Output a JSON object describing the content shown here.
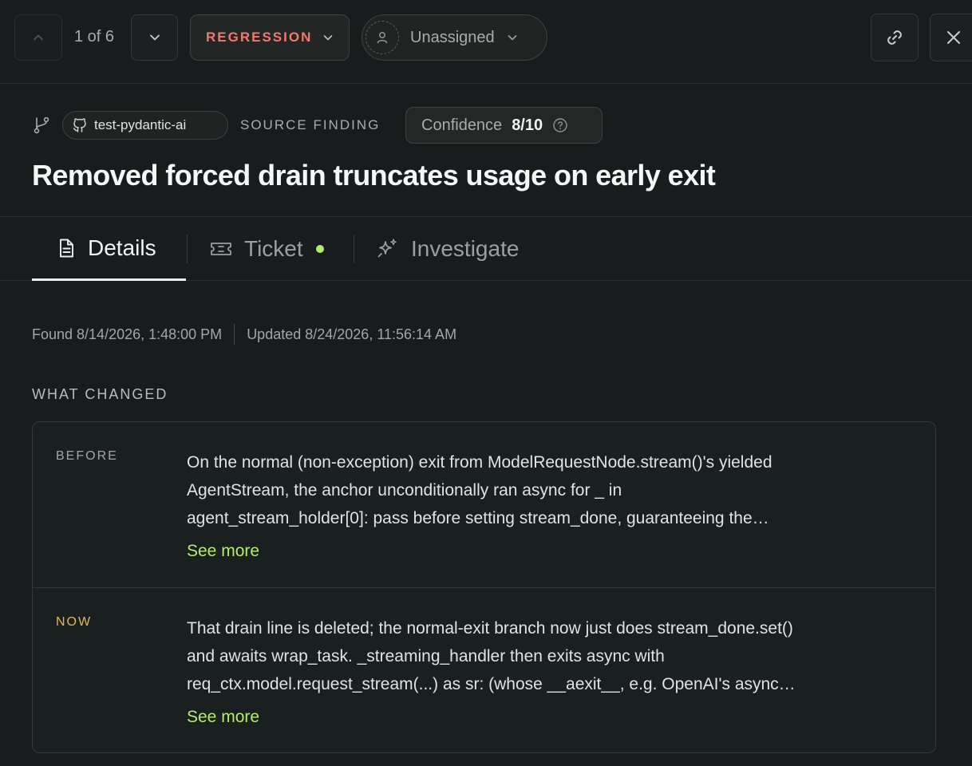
{
  "toolbar": {
    "pager": "1 of 6",
    "status": "REGRESSION",
    "assignee": "Unassigned"
  },
  "header": {
    "repo": "test-pydantic-ai",
    "source": "SOURCE FINDING",
    "confidence_label": "Confidence",
    "confidence_value": "8/10",
    "title": "Removed forced drain truncates usage on early exit"
  },
  "tabs": [
    {
      "label": "Details",
      "active": true,
      "icon": "document-icon"
    },
    {
      "label": "Ticket",
      "active": false,
      "icon": "ticket-icon",
      "indicator": true
    },
    {
      "label": "Investigate",
      "active": false,
      "icon": "sparkles-icon"
    }
  ],
  "timestamps": {
    "found": "Found 8/14/2026, 1:48:00 PM",
    "updated": "Updated 8/24/2026, 11:56:14 AM"
  },
  "what_changed": {
    "heading": "WHAT CHANGED",
    "before": {
      "label": "BEFORE",
      "lines": [
        "On the normal (non-exception) exit from ModelRequestNode.stream()'s yielded",
        "AgentStream, the anchor unconditionally ran async for _ in",
        "agent_stream_holder[0]: pass before setting stream_done, guaranteeing the…"
      ],
      "see_more": "See more"
    },
    "now": {
      "label": "NOW",
      "lines": [
        "That drain line is deleted; the normal-exit branch now just does stream_done.set()",
        "and awaits wrap_task. _streaming_handler then exits async with",
        "req_ctx.model.request_stream(...) as sr: (whose __aexit__, e.g. OpenAI's async…"
      ],
      "see_more": "See more"
    }
  },
  "colors": {
    "background": "#181c1c",
    "regression": "#f2776f",
    "accent_green": "#b4ec6d",
    "now_label": "#e5b659"
  }
}
